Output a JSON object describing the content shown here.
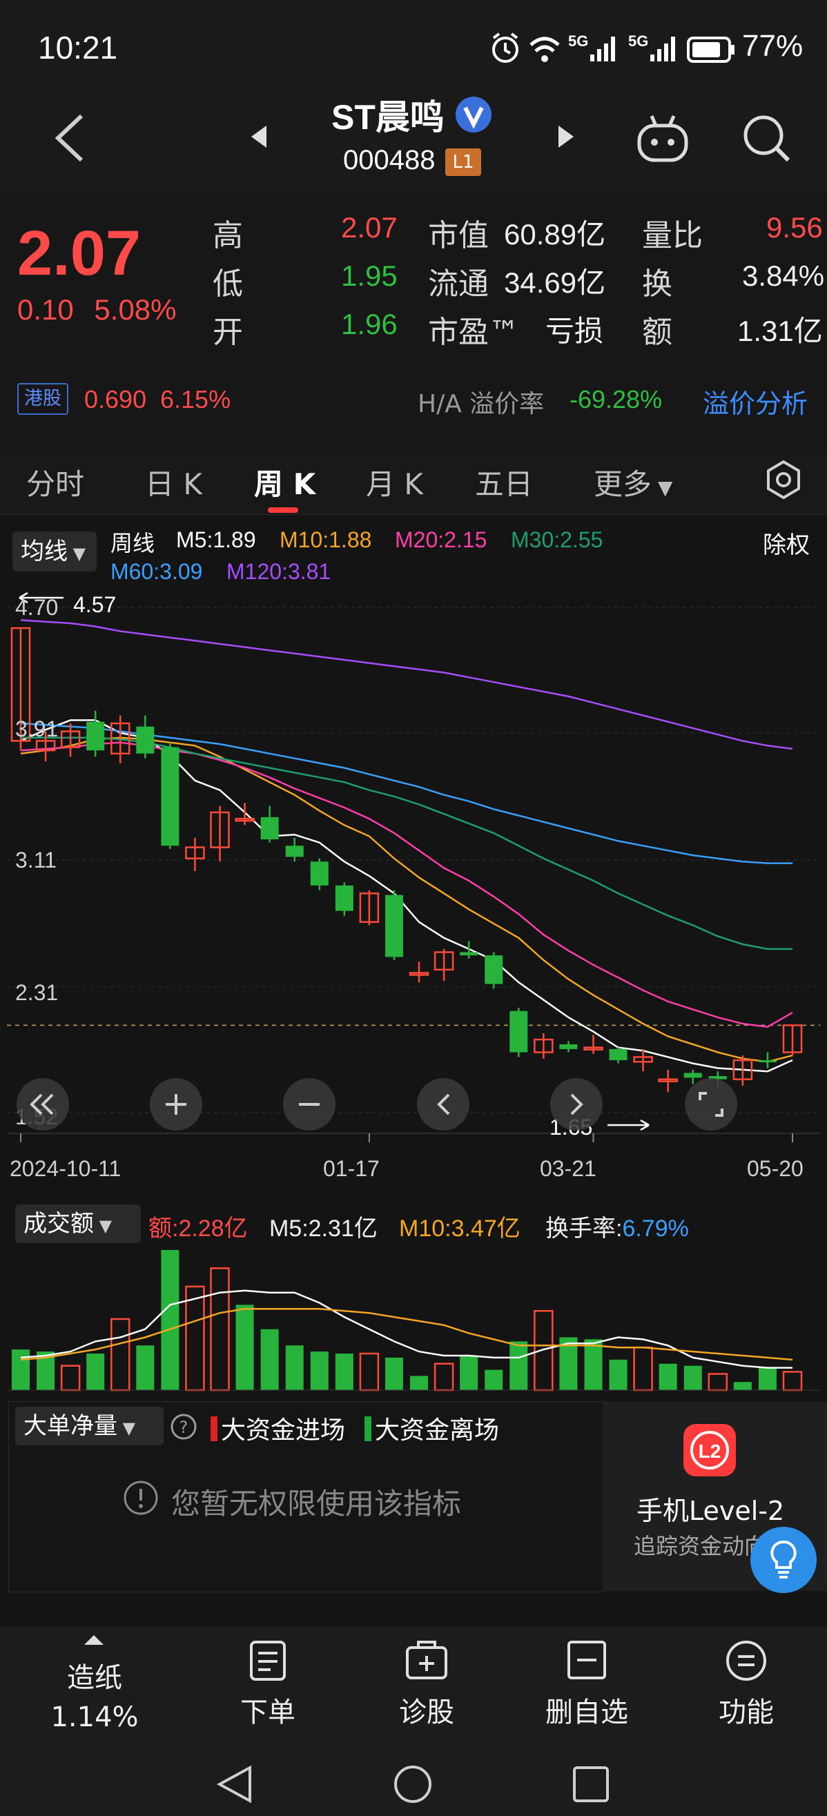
{
  "status_bar": {
    "time": "10:21",
    "network1": "5G",
    "network2": "5G",
    "battery": "77%"
  },
  "header": {
    "stock_name": "ST晨鸣",
    "stock_code": "000488",
    "level_badge": "L1"
  },
  "quote": {
    "price": "2.07",
    "change": "0.10",
    "change_pct": "5.08%",
    "stats": [
      {
        "label": "高",
        "value": "2.07"
      },
      {
        "label": "低",
        "value": "1.95"
      },
      {
        "label": "开",
        "value": "1.96"
      }
    ],
    "stats2": [
      {
        "label": "市值",
        "value": "60.89亿"
      },
      {
        "label": "流通",
        "value": "34.69亿"
      },
      {
        "label": "市盈™",
        "value": "亏损"
      }
    ],
    "stats3": [
      {
        "label": "量比",
        "value": "9.56"
      },
      {
        "label": "换",
        "value": "3.84%"
      },
      {
        "label": "额",
        "value": "1.31亿"
      }
    ],
    "hk": {
      "badge": "港股",
      "price": "0.690",
      "pct": "6.15%",
      "premium_label": "H/A 溢价率",
      "premium_value": "-69.28%",
      "premium_link": "溢价分析"
    }
  },
  "tabs": [
    "分时",
    "日 K",
    "周 K",
    "月 K",
    "五日",
    "更多"
  ],
  "legend": {
    "selector": "均线",
    "period": "周线",
    "ex_rights": "除权",
    "items": [
      {
        "label": "M5:1.89",
        "color": "#ffffff"
      },
      {
        "label": "M10:1.88",
        "color": "#f5a623"
      },
      {
        "label": "M20:2.15",
        "color": "#ff3fa8"
      },
      {
        "label": "M30:2.55",
        "color": "#1e9e6e"
      },
      {
        "label": "M60:3.09",
        "color": "#3aa0ff"
      },
      {
        "label": "M120:3.81",
        "color": "#a64dff"
      }
    ]
  },
  "chart_data": {
    "type": "candlestick",
    "y_ticks": [
      "4.70",
      "3.91",
      "3.11",
      "2.31",
      "1.52"
    ],
    "y_range": [
      1.52,
      4.7
    ],
    "x_ticks": [
      "2024-10-11",
      "01-17",
      "03-21",
      "05-20"
    ],
    "max_label": "4.57",
    "min_label": "1.65",
    "last_close": 2.07,
    "candles": [
      {
        "o": 3.86,
        "c": 4.57,
        "h": 4.57,
        "l": 3.8
      },
      {
        "o": 3.8,
        "c": 3.86,
        "h": 3.92,
        "l": 3.73
      },
      {
        "o": 3.82,
        "c": 3.92,
        "h": 3.97,
        "l": 3.76
      },
      {
        "o": 3.98,
        "c": 3.8,
        "h": 4.05,
        "l": 3.76
      },
      {
        "o": 3.78,
        "c": 3.97,
        "h": 4.02,
        "l": 3.72
      },
      {
        "o": 3.95,
        "c": 3.78,
        "h": 4.02,
        "l": 3.75
      },
      {
        "o": 3.82,
        "c": 3.2,
        "h": 3.85,
        "l": 3.18
      },
      {
        "o": 3.12,
        "c": 3.19,
        "h": 3.25,
        "l": 3.04
      },
      {
        "o": 3.19,
        "c": 3.41,
        "h": 3.45,
        "l": 3.1
      },
      {
        "o": 3.37,
        "c": 3.37,
        "h": 3.47,
        "l": 3.33
      },
      {
        "o": 3.38,
        "c": 3.24,
        "h": 3.45,
        "l": 3.22
      },
      {
        "o": 3.2,
        "c": 3.13,
        "h": 3.25,
        "l": 3.1
      },
      {
        "o": 3.1,
        "c": 2.95,
        "h": 3.12,
        "l": 2.92
      },
      {
        "o": 2.95,
        "c": 2.79,
        "h": 2.97,
        "l": 2.76
      },
      {
        "o": 2.72,
        "c": 2.9,
        "h": 2.92,
        "l": 2.7
      },
      {
        "o": 2.89,
        "c": 2.5,
        "h": 2.92,
        "l": 2.48
      },
      {
        "o": 2.4,
        "c": 2.4,
        "h": 2.47,
        "l": 2.34
      },
      {
        "o": 2.42,
        "c": 2.53,
        "h": 2.55,
        "l": 2.35
      },
      {
        "o": 2.53,
        "c": 2.51,
        "h": 2.6,
        "l": 2.49
      },
      {
        "o": 2.51,
        "c": 2.33,
        "h": 2.53,
        "l": 2.3
      },
      {
        "o": 2.16,
        "c": 1.9,
        "h": 2.18,
        "l": 1.87
      },
      {
        "o": 1.9,
        "c": 1.98,
        "h": 2.02,
        "l": 1.86
      },
      {
        "o": 1.95,
        "c": 1.92,
        "h": 1.97,
        "l": 1.9
      },
      {
        "o": 1.93,
        "c": 1.93,
        "h": 2.01,
        "l": 1.89
      },
      {
        "o": 1.92,
        "c": 1.85,
        "h": 1.93,
        "l": 1.83
      },
      {
        "o": 1.84,
        "c": 1.87,
        "h": 1.92,
        "l": 1.78
      },
      {
        "o": 1.73,
        "c": 1.73,
        "h": 1.79,
        "l": 1.65
      },
      {
        "o": 1.77,
        "c": 1.74,
        "h": 1.79,
        "l": 1.7
      },
      {
        "o": 1.75,
        "c": 1.73,
        "h": 1.78,
        "l": 1.68
      },
      {
        "o": 1.73,
        "c": 1.85,
        "h": 1.88,
        "l": 1.69
      },
      {
        "o": 1.85,
        "c": 1.84,
        "h": 1.9,
        "l": 1.8
      },
      {
        "o": 1.9,
        "c": 2.07,
        "h": 2.07,
        "l": 1.88
      }
    ],
    "ma": [
      {
        "name": "M5",
        "color": "#ffffff",
        "values": [
          3.86,
          3.93,
          3.99,
          3.99,
          3.91,
          3.88,
          3.77,
          3.61,
          3.55,
          3.41,
          3.26,
          3.27,
          3.22,
          3.1,
          3.01,
          2.9,
          2.72,
          2.62,
          2.55,
          2.48,
          2.34,
          2.23,
          2.12,
          2.03,
          1.93,
          1.91,
          1.87,
          1.83,
          1.8,
          1.79,
          1.78,
          1.85
        ]
      },
      {
        "name": "M10",
        "color": "#f5a623",
        "values": [
          3.78,
          3.8,
          3.83,
          3.87,
          3.88,
          3.87,
          3.85,
          3.83,
          3.76,
          3.68,
          3.6,
          3.52,
          3.42,
          3.33,
          3.26,
          3.12,
          3.0,
          2.9,
          2.8,
          2.71,
          2.62,
          2.48,
          2.36,
          2.26,
          2.17,
          2.08,
          2.0,
          1.95,
          1.9,
          1.86,
          1.84,
          1.88
        ]
      },
      {
        "name": "M20",
        "color": "#ff3fa8",
        "values": [
          3.8,
          3.81,
          3.82,
          3.84,
          3.85,
          3.83,
          3.8,
          3.78,
          3.74,
          3.69,
          3.63,
          3.56,
          3.5,
          3.44,
          3.37,
          3.28,
          3.17,
          3.06,
          2.98,
          2.88,
          2.77,
          2.64,
          2.54,
          2.45,
          2.37,
          2.29,
          2.22,
          2.17,
          2.12,
          2.08,
          2.06,
          2.15
        ]
      },
      {
        "name": "M30",
        "color": "#1e9e6e",
        "values": [
          3.88,
          3.88,
          3.88,
          3.88,
          3.87,
          3.85,
          3.82,
          3.78,
          3.75,
          3.72,
          3.69,
          3.66,
          3.63,
          3.6,
          3.55,
          3.51,
          3.46,
          3.4,
          3.34,
          3.28,
          3.2,
          3.12,
          3.05,
          2.98,
          2.9,
          2.83,
          2.76,
          2.7,
          2.63,
          2.58,
          2.55,
          2.55
        ]
      },
      {
        "name": "M60",
        "color": "#3aa0ff",
        "values": [
          3.97,
          3.96,
          3.95,
          3.94,
          3.92,
          3.9,
          3.88,
          3.86,
          3.84,
          3.81,
          3.78,
          3.75,
          3.72,
          3.69,
          3.65,
          3.61,
          3.57,
          3.52,
          3.48,
          3.43,
          3.39,
          3.35,
          3.31,
          3.27,
          3.23,
          3.2,
          3.17,
          3.14,
          3.12,
          3.1,
          3.09,
          3.09
        ]
      },
      {
        "name": "M120",
        "color": "#a64dff",
        "values": [
          4.62,
          4.61,
          4.6,
          4.58,
          4.55,
          4.53,
          4.51,
          4.49,
          4.47,
          4.45,
          4.43,
          4.41,
          4.39,
          4.37,
          4.35,
          4.33,
          4.31,
          4.29,
          4.26,
          4.23,
          4.2,
          4.17,
          4.14,
          4.1,
          4.06,
          4.02,
          3.98,
          3.94,
          3.9,
          3.86,
          3.83,
          3.81
        ]
      }
    ]
  },
  "volume": {
    "selector": "成交额",
    "amount_label": "额:2.28亿",
    "m5_label": "M5:2.31亿",
    "m10_label": "M10:3.47亿",
    "turnover_label": "换手率:",
    "turnover_value": "6.79%",
    "bars": [
      {
        "v": 2.0,
        "up": false
      },
      {
        "v": 1.9,
        "up": false
      },
      {
        "v": 1.2,
        "up": true
      },
      {
        "v": 1.8,
        "up": false
      },
      {
        "v": 3.5,
        "up": true
      },
      {
        "v": 2.2,
        "up": false
      },
      {
        "v": 6.9,
        "up": false
      },
      {
        "v": 5.1,
        "up": true
      },
      {
        "v": 6.0,
        "up": true
      },
      {
        "v": 4.2,
        "up": false
      },
      {
        "v": 3.0,
        "up": false
      },
      {
        "v": 2.2,
        "up": false
      },
      {
        "v": 1.9,
        "up": false
      },
      {
        "v": 1.8,
        "up": false
      },
      {
        "v": 1.8,
        "up": true
      },
      {
        "v": 1.6,
        "up": false
      },
      {
        "v": 0.7,
        "up": false
      },
      {
        "v": 1.3,
        "up": true
      },
      {
        "v": 1.7,
        "up": false
      },
      {
        "v": 1.0,
        "up": false
      },
      {
        "v": 2.4,
        "up": false
      },
      {
        "v": 3.9,
        "up": true
      },
      {
        "v": 2.6,
        "up": false
      },
      {
        "v": 2.5,
        "up": false
      },
      {
        "v": 1.5,
        "up": false
      },
      {
        "v": 2.1,
        "up": true
      },
      {
        "v": 1.3,
        "up": false
      },
      {
        "v": 1.2,
        "up": false
      },
      {
        "v": 0.8,
        "up": true
      },
      {
        "v": 0.4,
        "up": false
      },
      {
        "v": 1.1,
        "up": false
      },
      {
        "v": 0.9,
        "up": true
      }
    ],
    "m5": [
      1.6,
      1.7,
      1.9,
      2.4,
      2.6,
      3.0,
      4.2,
      4.5,
      4.8,
      4.9,
      4.8,
      4.8,
      4.3,
      3.6,
      3.0,
      2.4,
      1.9,
      1.7,
      1.7,
      1.6,
      1.6,
      2.0,
      2.3,
      2.3,
      2.6,
      2.5,
      2.2,
      1.6,
      1.4,
      1.2,
      1.1,
      1.1
    ],
    "m10": [
      1.5,
      1.6,
      1.8,
      2.0,
      2.3,
      2.6,
      3.0,
      3.4,
      3.8,
      4.0,
      4.0,
      4.0,
      4.0,
      3.9,
      3.8,
      3.6,
      3.4,
      3.2,
      2.8,
      2.5,
      2.2,
      2.2,
      2.2,
      2.2,
      2.1,
      2.1,
      2.0,
      1.9,
      1.8,
      1.7,
      1.6,
      1.5
    ]
  },
  "big_order": {
    "selector": "大单净量",
    "in_label": "大资金进场",
    "out_label": "大资金离场",
    "no_permission": "您暂无权限使用该指标"
  },
  "level2": {
    "logo": "L2",
    "title": "手机Level-2",
    "subtitle": "追踪资金动向"
  },
  "bottom_bar": [
    {
      "label": "造纸",
      "sub": "1.14%"
    },
    {
      "label": "下单"
    },
    {
      "label": "诊股"
    },
    {
      "label": "删自选"
    },
    {
      "label": "功能"
    }
  ]
}
